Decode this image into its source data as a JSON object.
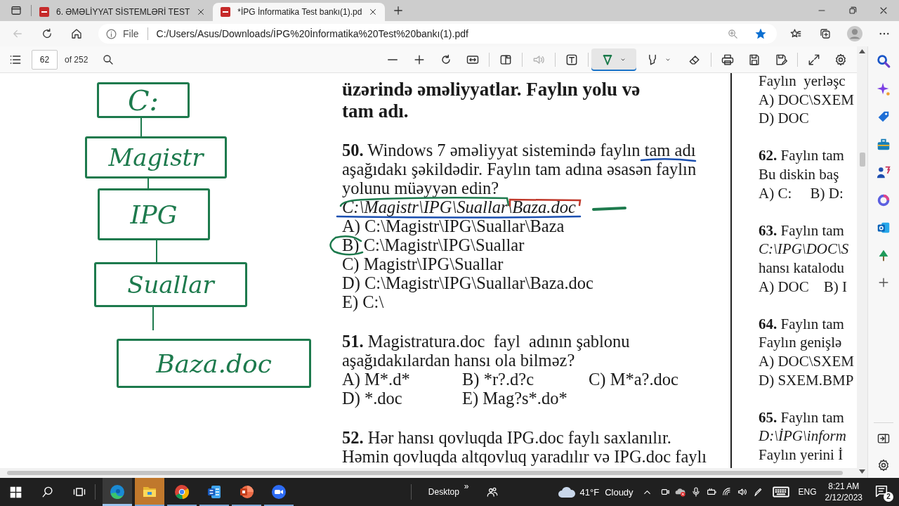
{
  "tabs": [
    {
      "title": "6. ƏMƏLİYYAT SİSTEMLƏRİ TEST",
      "selected": false
    },
    {
      "title": "*İPG İnformatika Test bankı(1).pd",
      "selected": true
    }
  ],
  "address_bar": {
    "scheme": "File",
    "url": "C:/Users/Asus/Downloads/İPG%20İnformatika%20Test%20bankı(1).pdf"
  },
  "pdf_toolbar": {
    "page": "62",
    "page_count": "of 252",
    "tools": [
      {
        "kind": "zoom-out",
        "selected": false,
        "disabled": false
      },
      {
        "kind": "zoom-in",
        "selected": false,
        "disabled": false
      },
      {
        "kind": "rotate",
        "selected": false,
        "disabled": false
      },
      {
        "kind": "fit-width",
        "selected": false,
        "disabled": false
      },
      {
        "kind": "page-view",
        "selected": false,
        "disabled": false
      },
      {
        "kind": "read-aloud",
        "selected": false,
        "disabled": true
      },
      {
        "kind": "add-text",
        "selected": false,
        "disabled": false
      },
      {
        "kind": "draw",
        "selected": true,
        "disabled": false
      },
      {
        "kind": "highlight",
        "selected": false,
        "disabled": false
      },
      {
        "kind": "erase",
        "selected": false,
        "disabled": false
      },
      {
        "kind": "print",
        "selected": false,
        "disabled": false
      },
      {
        "kind": "save",
        "selected": false,
        "disabled": false
      },
      {
        "kind": "save-as",
        "selected": false,
        "disabled": false
      },
      {
        "kind": "fullscreen",
        "selected": false,
        "disabled": false
      },
      {
        "kind": "settings",
        "selected": false,
        "disabled": false
      }
    ]
  },
  "diagram": {
    "nodes": [
      "C:",
      "Magistr",
      "IPG",
      "Suallar",
      "Baza.doc"
    ]
  },
  "page": {
    "heading": "üzərində əməliyyatlar. Faylın yolu və\ntam adı.",
    "questions": [
      {
        "text": "**50.** Windows 7 əməliyyat sistemində faylın tam adı\naşağıdakı şəkildədir. Faylın tam adına əsasən faylın\nyolunu müəyyən edin?",
        "path": "C:\\Magistr\\IPG\\Suallar\\Baza.doc",
        "kind": "list",
        "options": [
          "A) C:\\Magistr\\IPG\\Suallar\\Baza",
          "B) C:\\Magistr\\IPG\\Suallar",
          "C) Magistr\\IPG\\Suallar",
          "D) C:\\Magistr\\IPG\\Suallar\\Baza.doc",
          "E) C:\\"
        ]
      },
      {
        "text": "**51.** Magistratura.doc  fayl  adının şablonu\naşağıdakılardan hansı ola bilməz?",
        "kind": "grid",
        "options": [
          "A) M*.d*",
          "B) *r?.d?c",
          "C) M*a?.doc",
          "D) *.doc",
          "E) Mag?s*.do*"
        ]
      },
      {
        "text": "**52.** Hər hansı qovluqda IPG.doc faylı saxlanılır.\nHəmin qovluqda altqovluq yaradılır və IPG.doc faylı",
        "kind": "list"
      }
    ]
  },
  "right_page": {
    "blocks": [
      {
        "lines": [
          {
            "kind": "text",
            "text": "Faylın  yerləşc"
          },
          {
            "kind": "text",
            "text": "A) DOC\\SXEM"
          },
          {
            "kind": "text",
            "text": "D) DOC"
          }
        ]
      },
      {
        "lines": [
          {
            "kind": "text",
            "text": "**62.** Faylın tam"
          },
          {
            "kind": "text",
            "text": "Bu diskin baş"
          },
          {
            "kind": "text",
            "text": "A) C:     B) D:"
          }
        ]
      },
      {
        "lines": [
          {
            "kind": "text",
            "text": "**63.** Faylın tam"
          },
          {
            "kind": "path",
            "text": "C:\\IPG\\DOC\\S"
          },
          {
            "kind": "text",
            "text": "hansı katalodu"
          },
          {
            "kind": "text",
            "text": "A) DOC    B) I"
          }
        ]
      },
      {
        "lines": [
          {
            "kind": "text",
            "text": "**64.** Faylın tam"
          },
          {
            "kind": "text",
            "text": "Faylın genişlə"
          },
          {
            "kind": "text",
            "text": "A) DOC\\SXEM"
          },
          {
            "kind": "text",
            "text": "D) SXEM.BMP"
          }
        ]
      },
      {
        "lines": [
          {
            "kind": "text",
            "text": "**65.** Faylın tam"
          },
          {
            "kind": "path",
            "text": "D:\\İPG\\inform"
          },
          {
            "kind": "text",
            "text": "Faylın yerini İ"
          }
        ]
      }
    ]
  },
  "taskbar": {
    "apps": [
      {
        "kind": "edge",
        "active": true,
        "flashing": false
      },
      {
        "kind": "explorer",
        "active": false,
        "flashing": true
      },
      {
        "kind": "chrome",
        "active": false,
        "flashing": false
      },
      {
        "kind": "word",
        "active": false,
        "flashing": false
      },
      {
        "kind": "powerpoint",
        "active": false,
        "flashing": false
      },
      {
        "kind": "zoom",
        "active": false,
        "flashing": false
      }
    ],
    "desktop": "Desktop",
    "overflow": "»",
    "weather": {
      "temperature": "41°F",
      "condition": "Cloudy"
    },
    "language": "ENG",
    "time": "8:21 AM",
    "date": "2/12/2023",
    "notifications": "2"
  }
}
